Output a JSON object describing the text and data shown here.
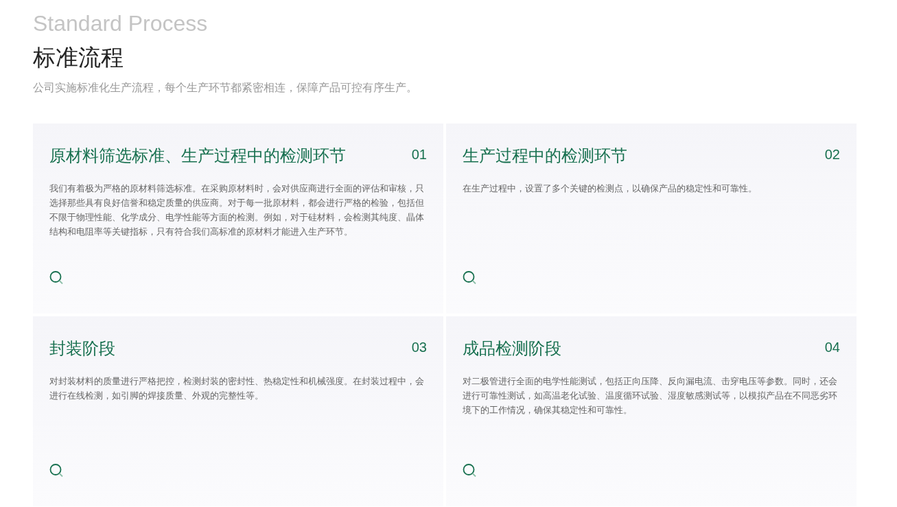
{
  "header": {
    "subtitle_en": "Standard Process",
    "title": "标准流程",
    "intro": "公司实施标准化生产流程，每个生产环节都紧密相连，保障产品可控有序生产。"
  },
  "cards": [
    {
      "title": "原材料筛选标准、生产过程中的检测环节",
      "number": "01",
      "text": "我们有着极为严格的原材料筛选标准。在采购原材料时，会对供应商进行全面的评估和审核，只选择那些具有良好信誉和稳定质量的供应商。对于每一批原材料，都会进行严格的检验，包括但不限于物理性能、化学成分、电学性能等方面的检测。例如，对于硅材料，会检测其纯度、晶体结构和电阻率等关键指标，只有符合我们高标准的原材料才能进入生产环节。"
    },
    {
      "title": "生产过程中的检测环节",
      "number": "02",
      "text": "在生产过程中，设置了多个关键的检测点，以确保产品的稳定性和可靠性。"
    },
    {
      "title": "封装阶段",
      "number": "03",
      "text": "对封装材料的质量进行严格把控，检测封装的密封性、热稳定性和机械强度。在封装过程中，会进行在线检测，如引脚的焊接质量、外观的完整性等。"
    },
    {
      "title": "成品检测阶段",
      "number": "04",
      "text": "对二极管进行全面的电学性能测试，包括正向压降、反向漏电流、击穿电压等参数。同时，还会进行可靠性测试，如高温老化试验、温度循环试验、湿度敏感测试等，以模拟产品在不同恶劣环境下的工作情况，确保其稳定性和可靠性。"
    }
  ]
}
